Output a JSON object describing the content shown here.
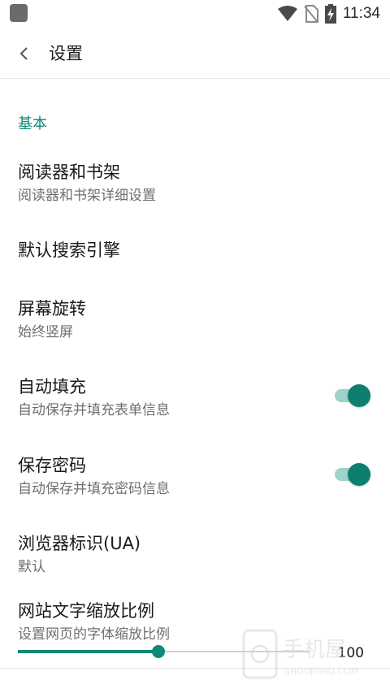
{
  "status_bar": {
    "time": "11:34",
    "icons": [
      "app-notification-icon",
      "wifi-icon",
      "no-sim-icon",
      "battery-charging-icon"
    ]
  },
  "toolbar": {
    "back_icon": "chevron-left-icon",
    "title": "设置"
  },
  "section": {
    "header": "基本"
  },
  "preferences": [
    {
      "title": "阅读器和书架",
      "summary": "阅读器和书架详细设置"
    },
    {
      "title": "默认搜索引擎",
      "summary": ""
    },
    {
      "title": "屏幕旋转",
      "summary": "始终竖屏"
    },
    {
      "title": "自动填充",
      "summary": "自动保存并填充表单信息",
      "switch_on": true
    },
    {
      "title": "保存密码",
      "summary": "自动保存并填充密码信息",
      "switch_on": true
    },
    {
      "title": "浏览器标识(UA)",
      "summary": "默认"
    },
    {
      "title": "网站文字缩放比例",
      "summary": "设置网页的字体缩放比例"
    }
  ],
  "text_scale_slider": {
    "value_label": "100",
    "fraction": 0.48
  },
  "colors": {
    "accent": "#0e8a7a",
    "switch_track": "#9fd2c9",
    "switch_thumb": "#0c7f6e"
  }
}
